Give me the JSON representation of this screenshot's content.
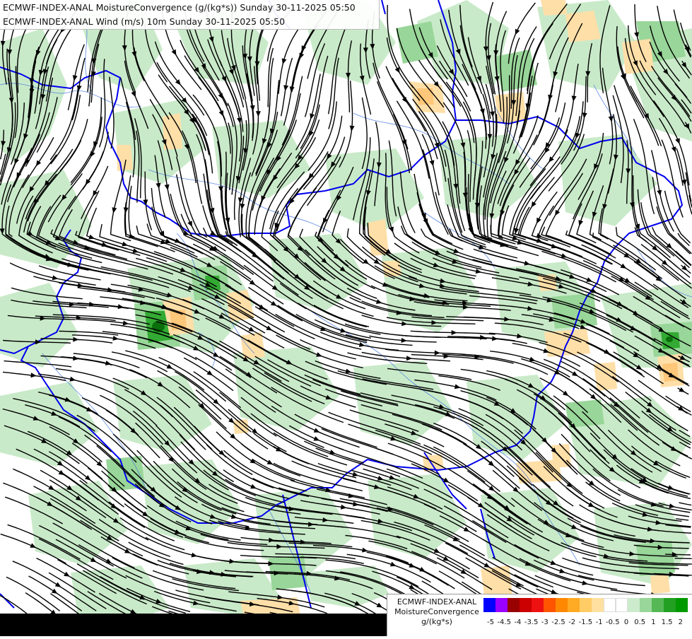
{
  "title_lines": [
    "ECMWF-INDEX-ANAL MoistureConvergence (g/(kg*s)) Sunday 30-11-2025 05:50",
    "ECMWF-INDEX-ANAL Wind (m/s) 10m Sunday 30-11-2025 05:50"
  ],
  "legend": {
    "line1": "ECMWF-INDEX-ANAL",
    "line2": "MoistureConvergence",
    "line3": "g/(kg*s)",
    "colors": [
      "#0000ff",
      "#9900ff",
      "#990000",
      "#cc0000",
      "#ee1111",
      "#ff5500",
      "#ff8800",
      "#ffaa22",
      "#ffcc66",
      "#ffe0a0",
      "#ffffff",
      "#ffffff",
      "#ccebcc",
      "#99d699",
      "#55b855",
      "#22a022",
      "#009900"
    ],
    "ticks": [
      "-5",
      "-4.5",
      "-4",
      "-3.5",
      "-3",
      "-2.5",
      "-2",
      "-1.5",
      "-1",
      "-0.5",
      "0",
      "0.5",
      "1",
      "1.5",
      "2"
    ]
  },
  "map": {
    "background": "#ffffff",
    "convergence_colors": {
      "weak_pos": "#c9eac9",
      "mid_pos": "#99d699",
      "strong_pos": "#33aa33",
      "peak": "#0a6e0a",
      "weak_neg": "#ffdfa8",
      "mid_neg": "#ffc77a"
    },
    "border_color": "#0000ee",
    "river_color": "#4477dd",
    "streamline_color": "#000000"
  }
}
